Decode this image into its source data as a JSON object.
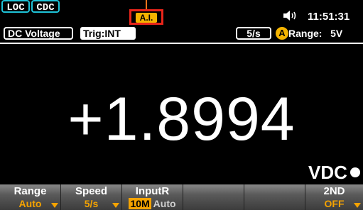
{
  "status": {
    "loc_label": "LOC",
    "cdc_label": "CDC",
    "ai_label": "A.I.",
    "speaker_icon": "speaker-icon",
    "time": "11:51:31"
  },
  "info": {
    "mode": "DC Voltage",
    "trigger": "Trig:INT",
    "rate": "5/s",
    "range_auto_badge": "A",
    "range_text": "Range:   5V"
  },
  "display": {
    "reading": "+1.8994",
    "unit": "VDC"
  },
  "softkeys": [
    {
      "label": "Range",
      "value": "Auto"
    },
    {
      "label": "Speed",
      "value": "5/s"
    },
    {
      "label": "InputR",
      "value": "10M",
      "value2": "Auto"
    },
    {
      "label": "",
      "value": ""
    },
    {
      "label": "",
      "value": ""
    },
    {
      "label": "2ND",
      "value": "OFF"
    }
  ],
  "colors": {
    "accent_orange": "#f5a300",
    "callout_red": "#e8251a",
    "cyan_border": "#1ec3d8"
  }
}
